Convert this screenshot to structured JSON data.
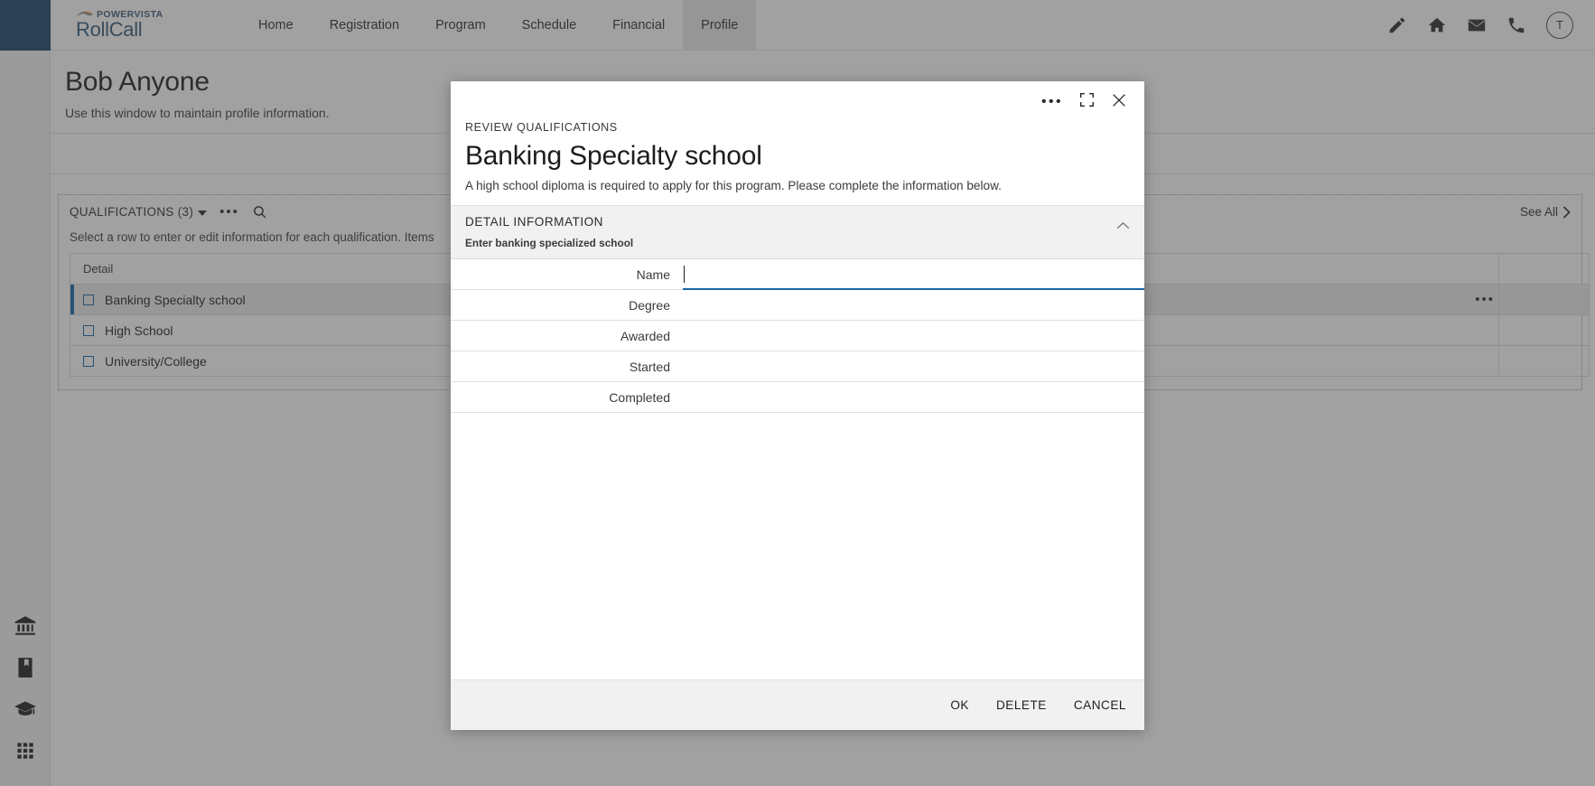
{
  "app": {
    "brand": {
      "top": "POWERVISTA",
      "main": "RollCall",
      "swoosh_icon": "swoosh-icon"
    },
    "accent_blue": "#1565a8",
    "rail_top_color": "#1b4269"
  },
  "nav": {
    "items": [
      {
        "label": "Home",
        "active": false
      },
      {
        "label": "Registration",
        "active": false
      },
      {
        "label": "Program",
        "active": false
      },
      {
        "label": "Schedule",
        "active": false
      },
      {
        "label": "Financial",
        "active": false
      },
      {
        "label": "Profile",
        "active": true
      }
    ]
  },
  "topbar_right": {
    "icons": [
      "pencil-icon",
      "home-icon",
      "mail-icon",
      "phone-icon"
    ],
    "avatar_initial": "T"
  },
  "rail": {
    "icons": [
      "bank-icon",
      "book-icon",
      "graduation-cap-icon",
      "grid-apps-icon"
    ]
  },
  "page": {
    "title": "Bob Anyone",
    "subtitle": "Use this window to maintain profile information."
  },
  "panel": {
    "title": "QUALIFICATIONS (3)",
    "see_all": "See All",
    "subtitle": "Select a row to enter or edit information for each qualification. Items",
    "columns": [
      "Detail",
      ""
    ],
    "rows": [
      {
        "detail": "Banking Specialty school",
        "selected": true
      },
      {
        "detail": "High School",
        "selected": false
      },
      {
        "detail": "University/College",
        "selected": false
      }
    ]
  },
  "modal": {
    "eyebrow": "REVIEW QUALIFICATIONS",
    "title": "Banking Specialty school",
    "description": "A high school diploma is required to apply for this program. Please complete the information below.",
    "header_icons": [
      "more-icon",
      "expand-icon",
      "close-icon"
    ],
    "section": {
      "title": "DETAIL INFORMATION",
      "hint": "Enter banking specialized school",
      "collapse_icon": "chevron-up-icon"
    },
    "fields": [
      {
        "label": "Name",
        "value": "",
        "focused": true
      },
      {
        "label": "Degree",
        "value": "",
        "focused": false
      },
      {
        "label": "Awarded",
        "value": "",
        "focused": false
      },
      {
        "label": "Started",
        "value": "",
        "focused": false
      },
      {
        "label": "Completed",
        "value": "",
        "focused": false
      }
    ],
    "buttons": [
      {
        "label": "OK"
      },
      {
        "label": "DELETE"
      },
      {
        "label": "CANCEL"
      }
    ]
  }
}
